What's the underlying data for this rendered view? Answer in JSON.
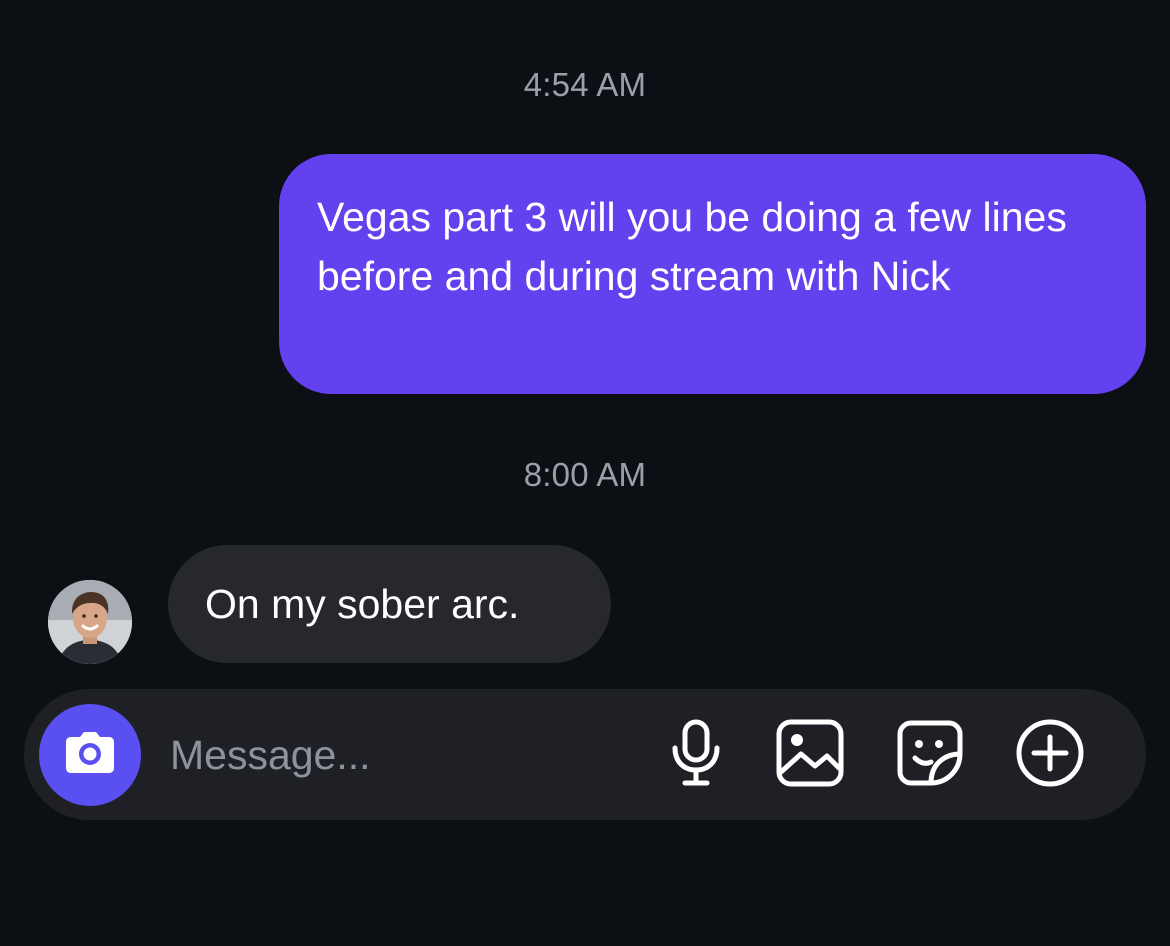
{
  "thread": {
    "messages": [
      {
        "timestamp": "4:54 AM",
        "direction": "outgoing",
        "text": "Vegas part 3 will you be doing a few lines before and during stream with Nick"
      },
      {
        "timestamp": "8:00 AM",
        "direction": "incoming",
        "text": "On my sober arc."
      }
    ]
  },
  "composer": {
    "placeholder": "Message...",
    "value": "",
    "icons": {
      "camera": "camera-icon",
      "mic": "microphone-icon",
      "gallery": "image-gallery-icon",
      "sticker": "sticker-icon",
      "more": "plus-circle-icon"
    }
  },
  "colors": {
    "background": "#0c0f14",
    "outgoing_bubble": "#6441ee",
    "incoming_bubble": "#26282d",
    "composer_bar": "#1e2025",
    "camera_button": "#5a4ff0",
    "timestamp_text": "#9aa0a8"
  }
}
